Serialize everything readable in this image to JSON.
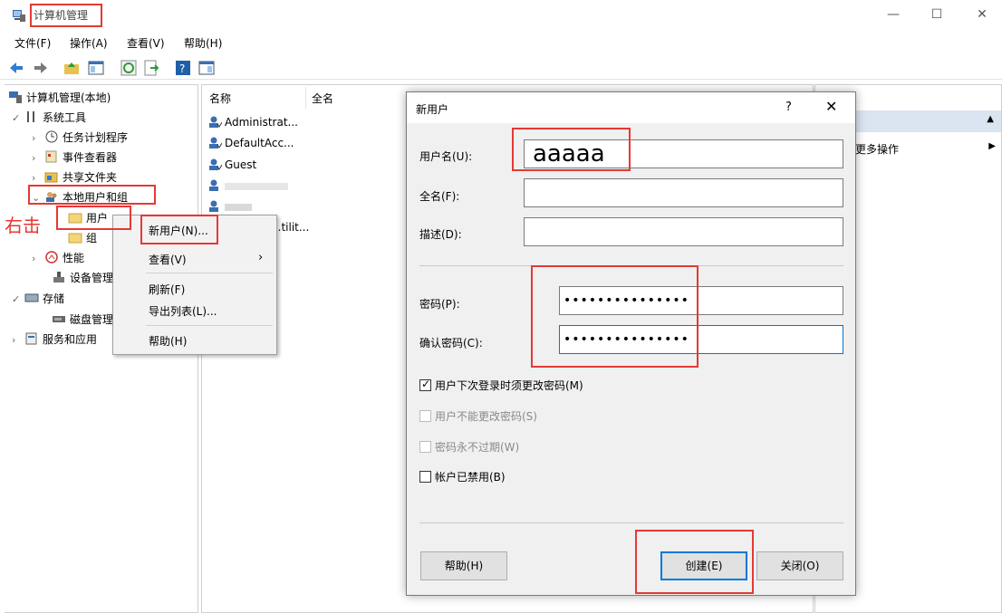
{
  "window": {
    "title": "计算机管理",
    "minimize": "—",
    "maximize": "☐",
    "close": "✕"
  },
  "menu": [
    "文件(F)",
    "操作(A)",
    "查看(V)",
    "帮助(H)"
  ],
  "tree": {
    "root": "计算机管理(本地)",
    "system_tools": "系统工具",
    "task_scheduler": "任务计划程序",
    "event_viewer": "事件查看器",
    "shared_folders": "共享文件夹",
    "local_users_groups": "本地用户和组",
    "users": "用户",
    "groups": "组",
    "performance": "性能",
    "device_manager": "设备管理",
    "storage": "存储",
    "disk_management": "磁盘管理",
    "services_apps": "服务和应用"
  },
  "list": {
    "columns": [
      "名称",
      "全名"
    ],
    "rows": [
      "Administrat...",
      "DefaultAcc...",
      "Guest",
      "",
      "",
      "...tilit..."
    ]
  },
  "actions": {
    "more": "更多操作"
  },
  "context_menu": {
    "new_user": "新用户(N)...",
    "view": "查看(V)",
    "refresh": "刷新(F)",
    "export": "导出列表(L)...",
    "help": "帮助(H)"
  },
  "dialog": {
    "title": "新用户",
    "help_icon": "?",
    "close_icon": "✕",
    "username_label": "用户名(U):",
    "username_value": "aaaaa",
    "fullname_label": "全名(F):",
    "fullname_value": "",
    "description_label": "描述(D):",
    "description_value": "",
    "password_label": "密码(P):",
    "password_value": "•••••••••••••••",
    "confirm_label": "确认密码(C):",
    "confirm_value": "•••••••••••••••",
    "checkboxes": [
      {
        "label": "用户下次登录时须更改密码(M)",
        "checked": true,
        "enabled": true
      },
      {
        "label": "用户不能更改密码(S)",
        "checked": false,
        "enabled": false
      },
      {
        "label": "密码永不过期(W)",
        "checked": false,
        "enabled": false
      },
      {
        "label": "帐户已禁用(B)",
        "checked": false,
        "enabled": true
      }
    ],
    "help_button": "帮助(H)",
    "create_button": "创建(E)",
    "close_button": "关闭(O)"
  },
  "annotation": {
    "right_click": "右击"
  },
  "colors": {
    "annotation_red": "#e53935",
    "accent_blue": "#0078d7"
  }
}
